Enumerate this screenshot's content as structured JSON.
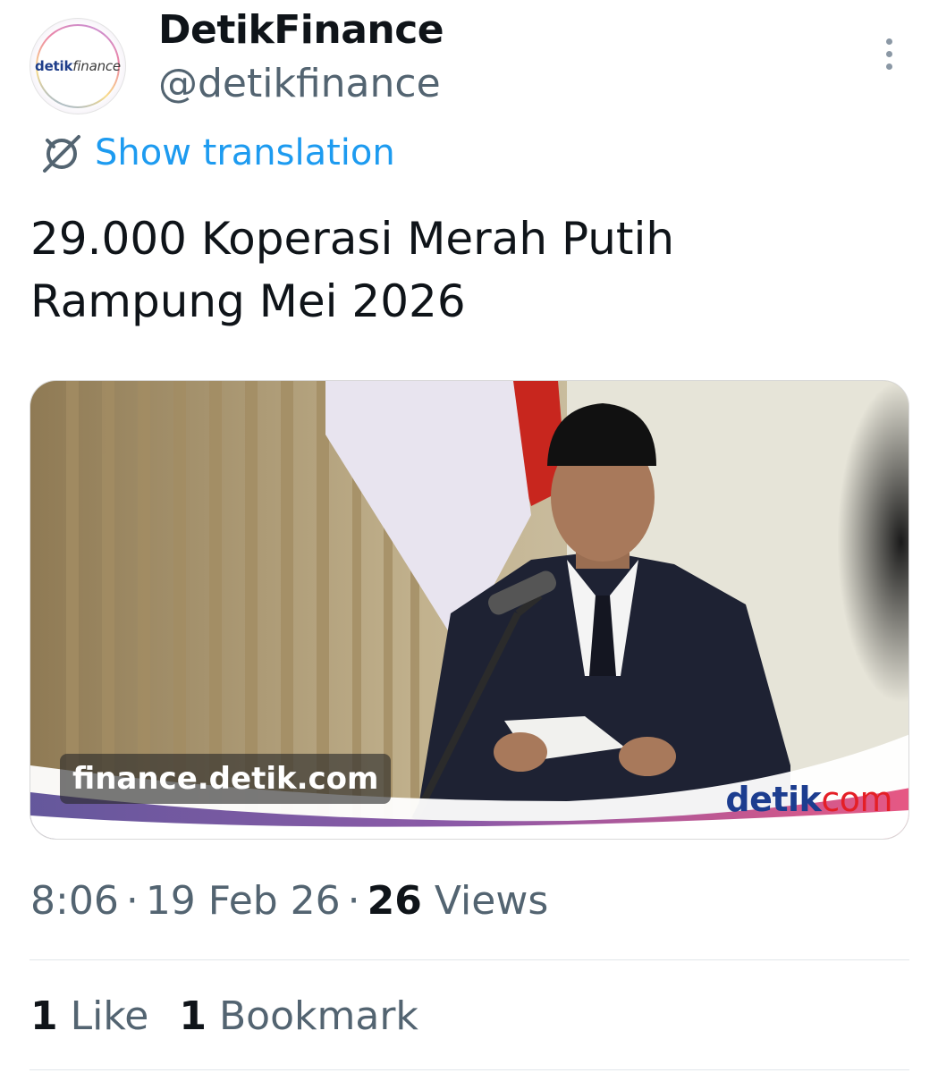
{
  "author": {
    "display_name": "DetikFinance",
    "handle": "@detikfinance",
    "avatar_logo_prefix": "detik",
    "avatar_logo_suffix": "finance"
  },
  "translate": {
    "label": "Show translation",
    "icon": "translate-icon"
  },
  "tweet": {
    "text": "29.000 Koperasi Merah Putih Rampung Mei 2026"
  },
  "media": {
    "watermark": "finance.detik.com",
    "brand_prefix": "detik",
    "brand_suffix": "com"
  },
  "meta": {
    "time": "8:06",
    "date": "19 Feb 26",
    "separator": "·",
    "views_count": "26",
    "views_label": "Views"
  },
  "engagement": {
    "likes_count": "1",
    "likes_label": "Like",
    "bookmarks_count": "1",
    "bookmarks_label": "Bookmark"
  },
  "colors": {
    "accent": "#1d9bf0",
    "text_primary": "#0f1419",
    "text_secondary": "#536471",
    "brand_blue": "#1c3d8f",
    "brand_red": "#e41f26"
  }
}
